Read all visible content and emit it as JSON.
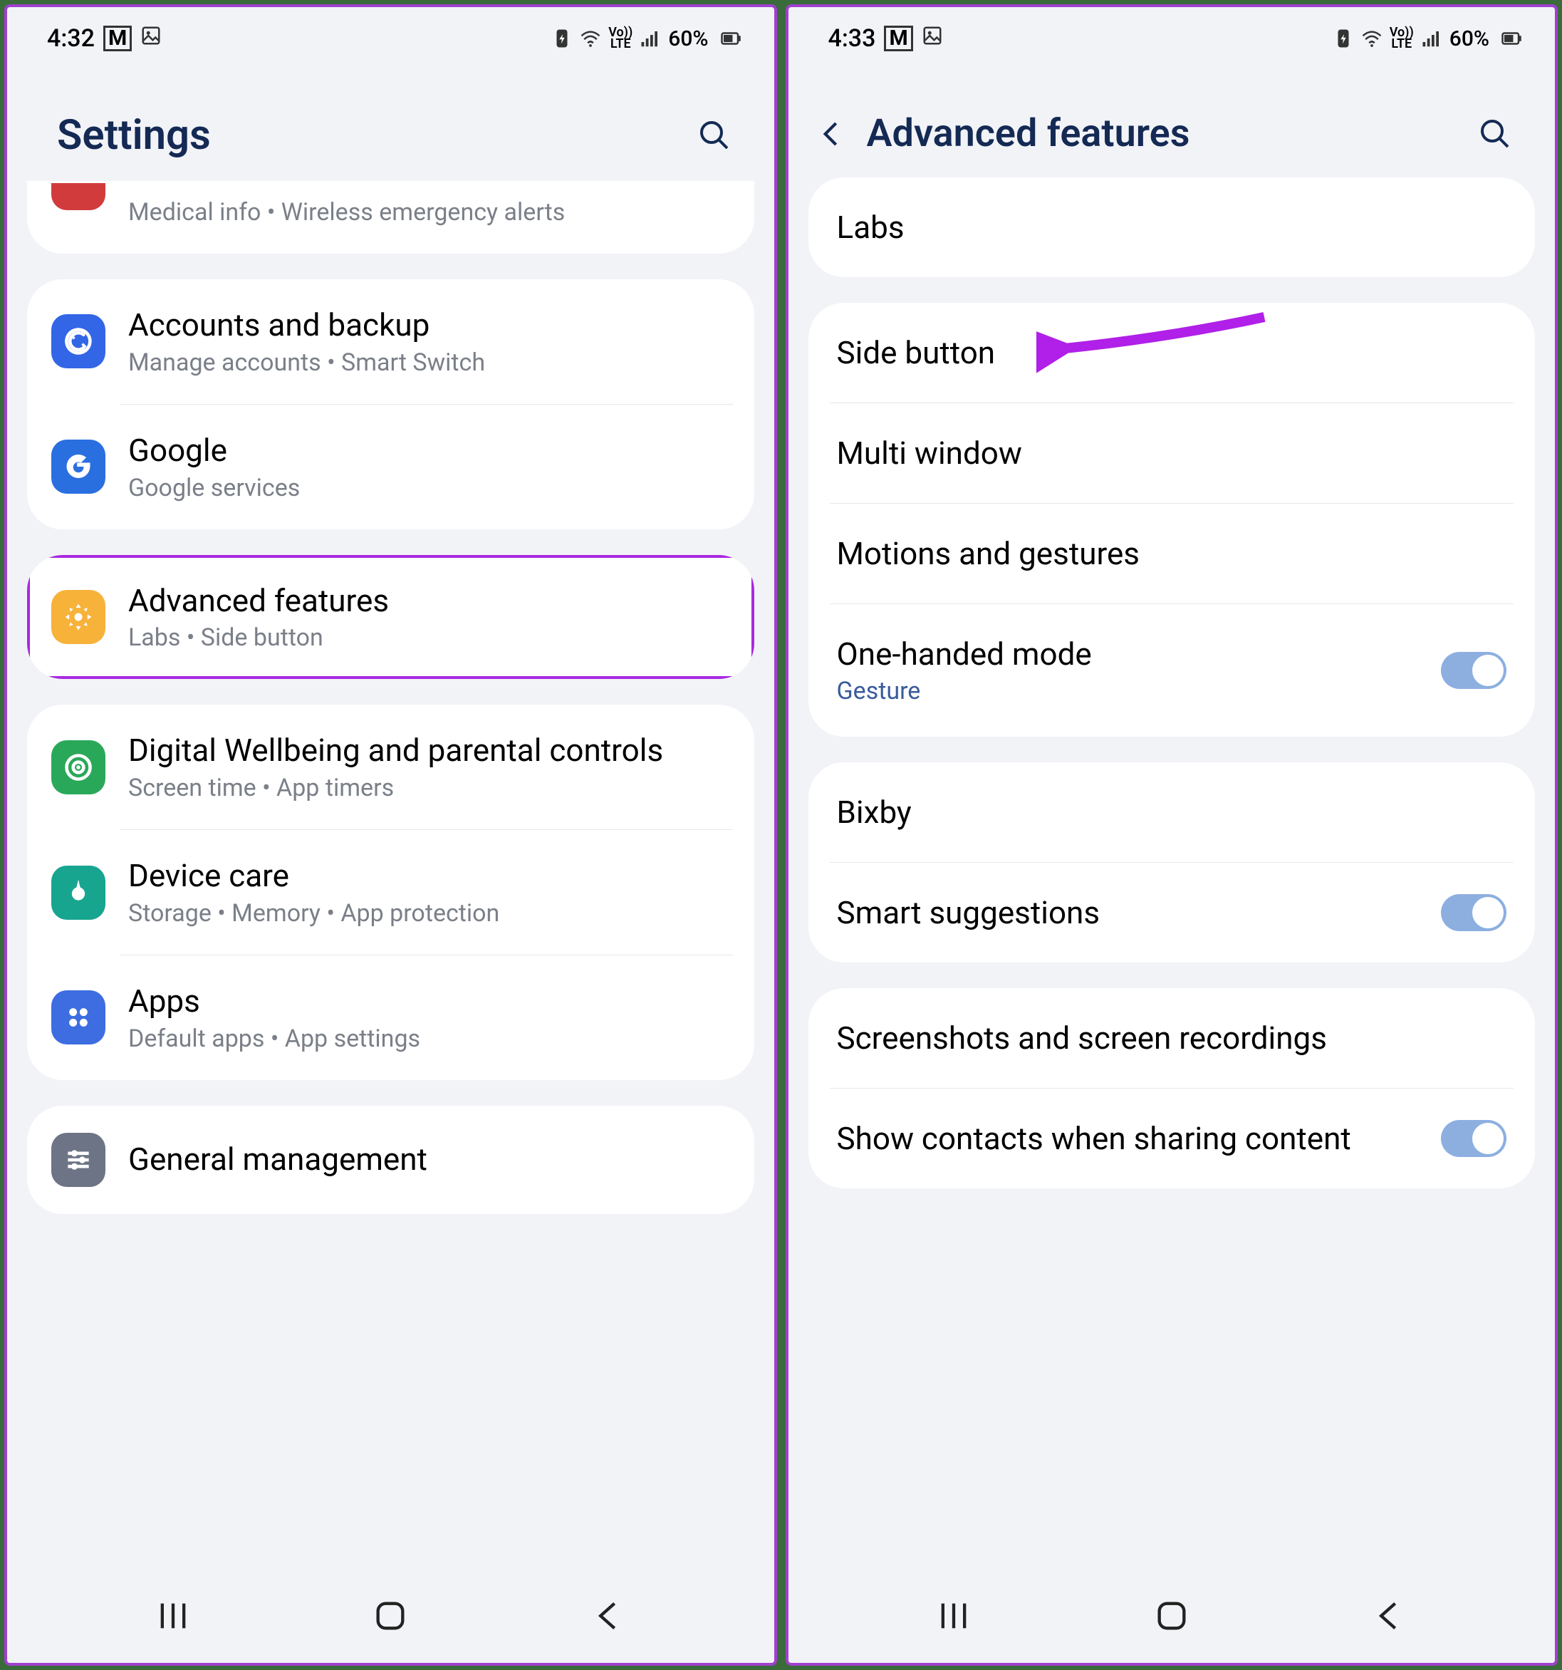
{
  "left": {
    "status": {
      "time": "4:32",
      "battery": "60%"
    },
    "title": "Settings",
    "partial_row": {
      "sub": "Medical info  •  Wireless emergency alerts"
    },
    "groups": [
      {
        "rows": [
          {
            "title": "Accounts and backup",
            "sub": "Manage accounts  •  Smart Switch",
            "iconClass": "ic-blue",
            "name": "accounts-backup"
          },
          {
            "title": "Google",
            "sub": "Google services",
            "iconClass": "ic-gblue",
            "name": "google"
          }
        ]
      },
      {
        "rows": [
          {
            "title": "Advanced features",
            "sub": "Labs  •  Side button",
            "iconClass": "ic-orange",
            "highlight": true,
            "name": "advanced-features"
          }
        ]
      },
      {
        "rows": [
          {
            "title": "Digital Wellbeing and parental controls",
            "sub": "Screen time  •  App timers",
            "iconClass": "ic-green",
            "name": "digital-wellbeing"
          },
          {
            "title": "Device care",
            "sub": "Storage  •  Memory  •  App protection",
            "iconClass": "ic-teal",
            "name": "device-care"
          },
          {
            "title": "Apps",
            "sub": "Default apps  •  App settings",
            "iconClass": "ic-pblue",
            "name": "apps"
          }
        ]
      },
      {
        "rows": [
          {
            "title": "General management",
            "sub": "",
            "iconClass": "ic-grey",
            "name": "general-management"
          }
        ]
      }
    ]
  },
  "right": {
    "status": {
      "time": "4:33",
      "battery": "60%"
    },
    "title": "Advanced features",
    "groups": [
      {
        "rows": [
          {
            "title": "Labs",
            "name": "labs"
          }
        ]
      },
      {
        "rows": [
          {
            "title": "Side button",
            "arrow": true,
            "name": "side-button"
          },
          {
            "title": "Multi window",
            "name": "multi-window"
          },
          {
            "title": "Motions and gestures",
            "name": "motions-gestures"
          },
          {
            "title": "One-handed mode",
            "sub": "Gesture",
            "toggle": true,
            "name": "one-handed-mode"
          }
        ]
      },
      {
        "rows": [
          {
            "title": "Bixby",
            "name": "bixby"
          },
          {
            "title": "Smart suggestions",
            "toggle": true,
            "name": "smart-suggestions"
          }
        ]
      },
      {
        "rows": [
          {
            "title": "Screenshots and screen recordings",
            "name": "screenshots-recordings"
          },
          {
            "title": "Show contacts when sharing content",
            "toggle": true,
            "name": "show-contacts-sharing"
          }
        ]
      }
    ]
  }
}
